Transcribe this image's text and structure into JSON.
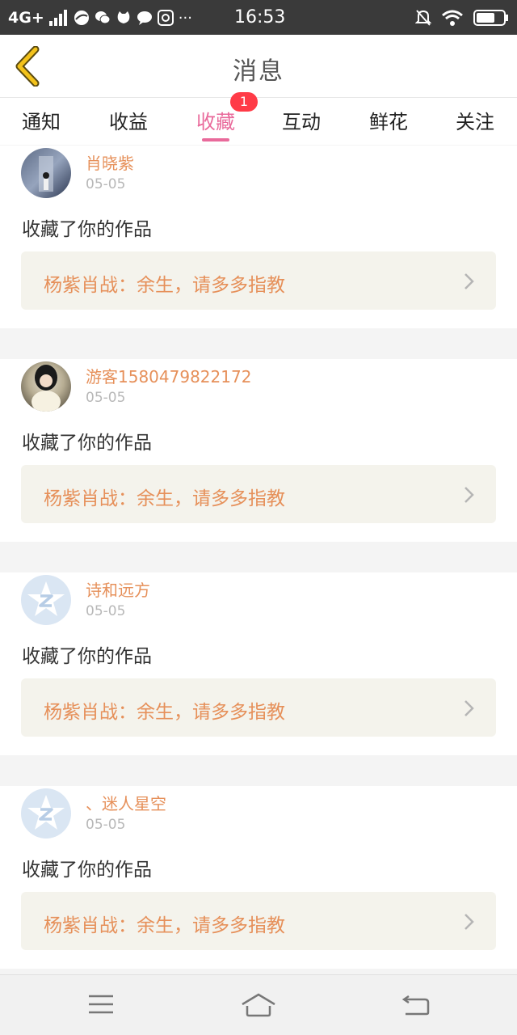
{
  "status_bar": {
    "carrier": "4G+",
    "time": "16:53",
    "more": "···"
  },
  "header": {
    "title": "消息"
  },
  "tabs": [
    {
      "label": "通知"
    },
    {
      "label": "收益"
    },
    {
      "label": "收藏",
      "active": true,
      "badge": "1"
    },
    {
      "label": "互动"
    },
    {
      "label": "鲜花"
    },
    {
      "label": "关注"
    }
  ],
  "feed": [
    {
      "user": "肖晓紫",
      "time": "05-05",
      "action": "收藏了你的作品",
      "work": "杨紫肖战：余生，请多多指教",
      "avatar": "photo"
    },
    {
      "user": "游客1580479822172",
      "time": "05-05",
      "action": "收藏了你的作品",
      "work": "杨紫肖战：余生，请多多指教",
      "avatar": "photo"
    },
    {
      "user": "诗和远方",
      "time": "05-05",
      "action": "收藏了你的作品",
      "work": "杨紫肖战：余生，请多多指教",
      "avatar": "default-qq-icon"
    },
    {
      "user": "、迷人星空",
      "time": "05-05",
      "action": "收藏了你的作品",
      "work": "杨紫肖战：余生，请多多指教",
      "avatar": "default-qq-icon"
    }
  ],
  "colors": {
    "accent": "#e96a9b",
    "username": "#e6905a",
    "badge": "#ff3b47",
    "back_arrow": "#f3c21b"
  }
}
